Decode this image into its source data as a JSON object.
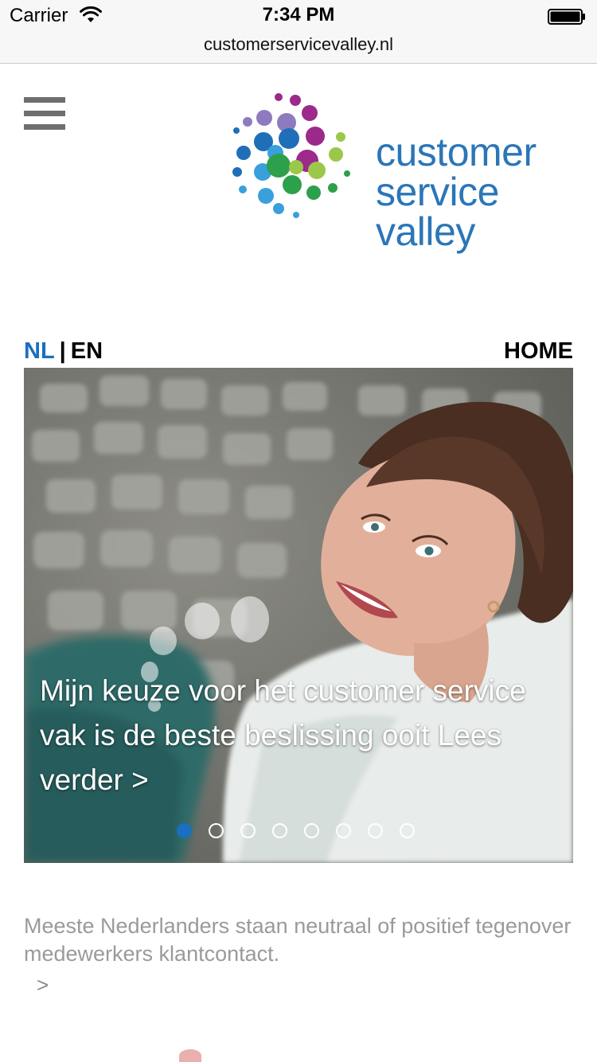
{
  "status_bar": {
    "carrier": "Carrier",
    "time": "7:34 PM",
    "icons": [
      "wifi-icon",
      "battery-icon"
    ]
  },
  "browser": {
    "url": "customerservicevalley.nl"
  },
  "header": {
    "menu_icon": "hamburger-menu-icon",
    "logo_lines": [
      "customer",
      "service",
      "valley"
    ],
    "brand_color": "#2a76b8"
  },
  "nav": {
    "lang_nl": "NL",
    "lang_separator": "|",
    "lang_en": "EN",
    "active_language": "NL",
    "home": "HOME",
    "accent_color": "#1a6fc0"
  },
  "hero": {
    "caption": "Mijn keuze voor het customer service vak is de beste beslissing ooit Lees verder >",
    "slide_count": 8,
    "active_slide": 1
  },
  "teaser": {
    "text": "Meeste Nederlanders staan neutraal of positief tegenover medewerkers klantcontact.",
    "arrow": ">"
  }
}
